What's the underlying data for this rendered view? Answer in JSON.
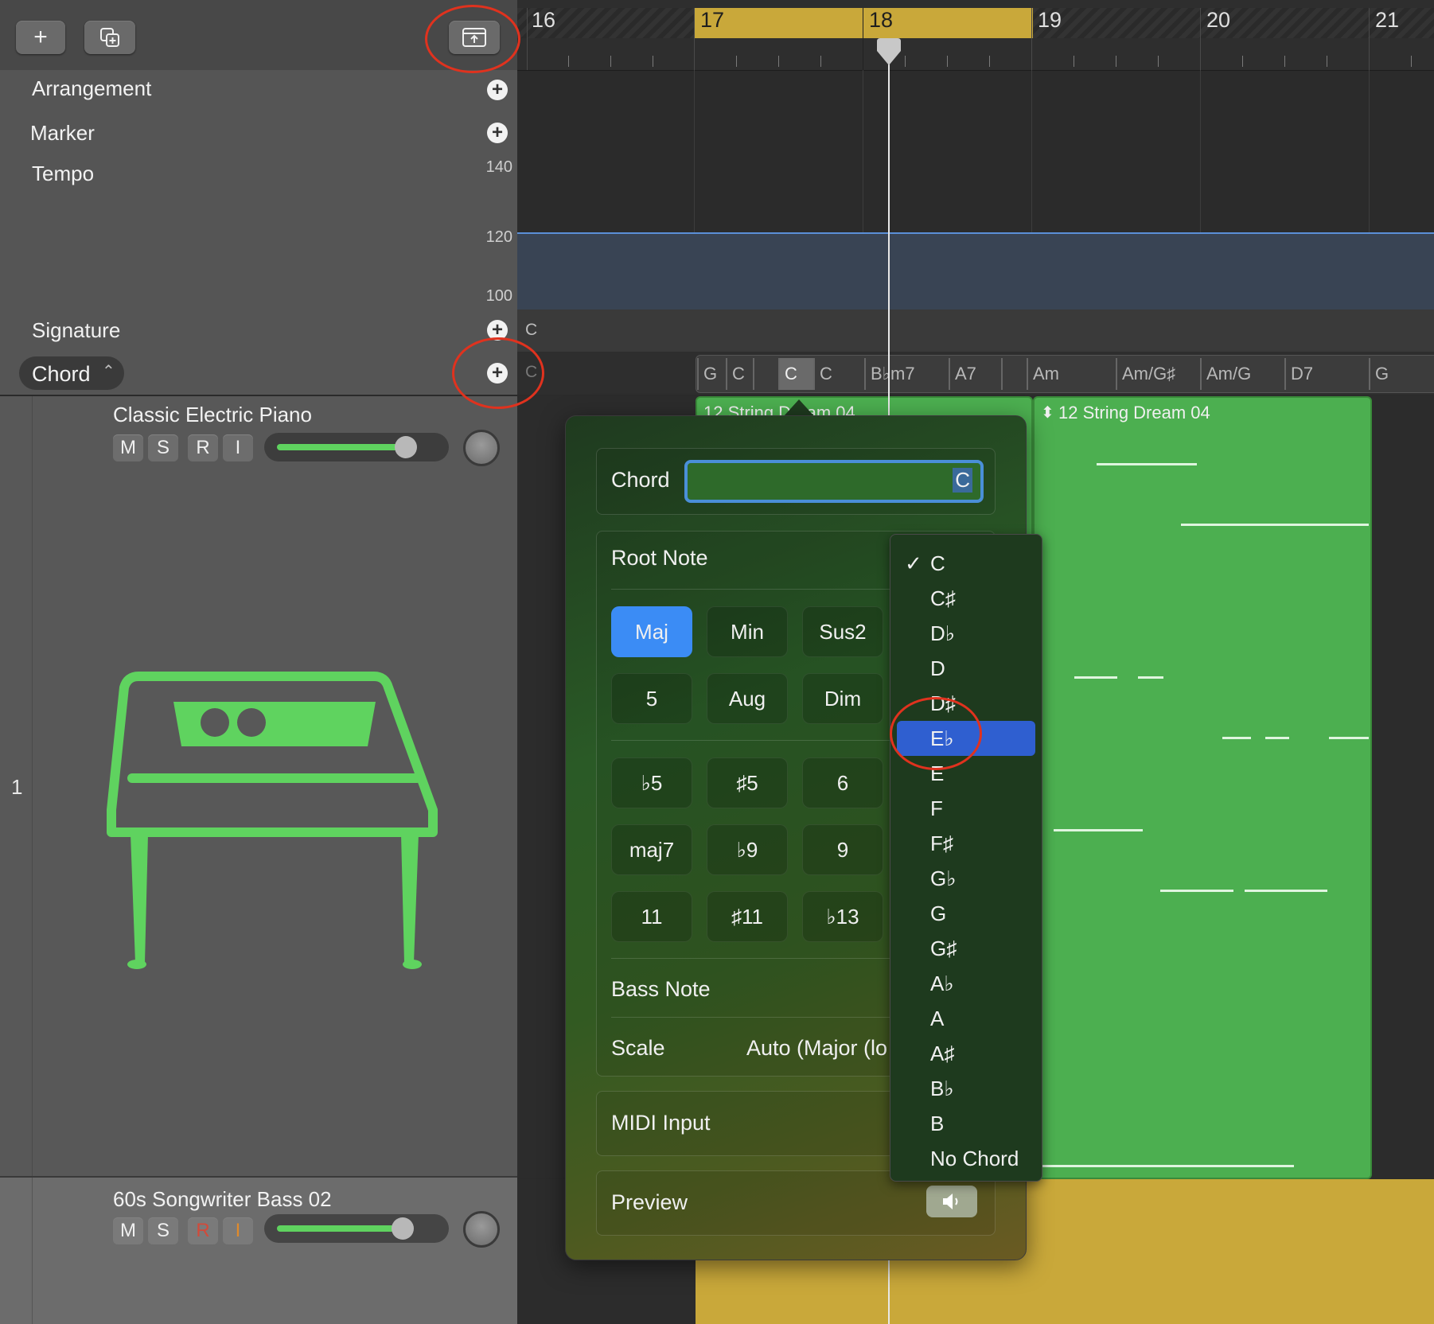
{
  "toolbar": {
    "add": "+",
    "duplicate": "⧉",
    "global_tracks": "⇪"
  },
  "global_tracks": {
    "arrangement": "Arrangement",
    "marker": "Marker",
    "tempo": "Tempo",
    "tempo_scale": [
      "140",
      "120",
      "100"
    ],
    "signature": "Signature",
    "signature_value": "C",
    "chord": "Chord",
    "chord_value": "C"
  },
  "ruler": {
    "bars": [
      "16",
      "17",
      "18",
      "19",
      "20",
      "21"
    ]
  },
  "chord_track": {
    "segments": [
      "G",
      "C",
      "C",
      "C",
      "B♭m7",
      "A7",
      "Am",
      "Am/G♯",
      "Am/G",
      "D7",
      "G"
    ]
  },
  "tracks": [
    {
      "number": "1",
      "name": "Classic Electric Piano",
      "buttons": [
        "M",
        "S",
        "R",
        "I"
      ],
      "volume": 0.75
    },
    {
      "number": "",
      "name": "60s Songwriter Bass 02",
      "buttons": [
        "M",
        "S",
        "R",
        "I"
      ],
      "volume": 0.72
    }
  ],
  "regions": [
    {
      "title": "12 String Dream 04"
    },
    {
      "title": "12 String Dream 04"
    }
  ],
  "chord_popover": {
    "chord_label": "Chord",
    "chord_value": "C",
    "root_note_label": "Root Note",
    "qualities": [
      "Maj",
      "Min",
      "Sus2",
      "5",
      "Aug",
      "Dim"
    ],
    "extensions": [
      "♭5",
      "♯5",
      "6",
      "maj7",
      "♭9",
      "9",
      "11",
      "♯11",
      "♭13"
    ],
    "bass_note_label": "Bass Note",
    "scale_label": "Scale",
    "scale_value": "Auto (Major (lo",
    "midi_input_label": "MIDI Input",
    "preview_label": "Preview",
    "selected_quality": "Maj"
  },
  "root_note_menu": {
    "items": [
      "C",
      "C♯",
      "D♭",
      "D",
      "D♯",
      "E♭",
      "E",
      "F",
      "F♯",
      "G♭",
      "G",
      "G♯",
      "A♭",
      "A",
      "A♯",
      "B♭",
      "B",
      "No Chord"
    ],
    "checked": "C",
    "highlighted": "E♭"
  },
  "colors": {
    "accent_blue": "#3b8cf5",
    "region_green": "#4caf50",
    "region_yellow": "#c9a83a",
    "annotation_red": "#e0321e",
    "ruler_cycle": "#c9a83a"
  }
}
